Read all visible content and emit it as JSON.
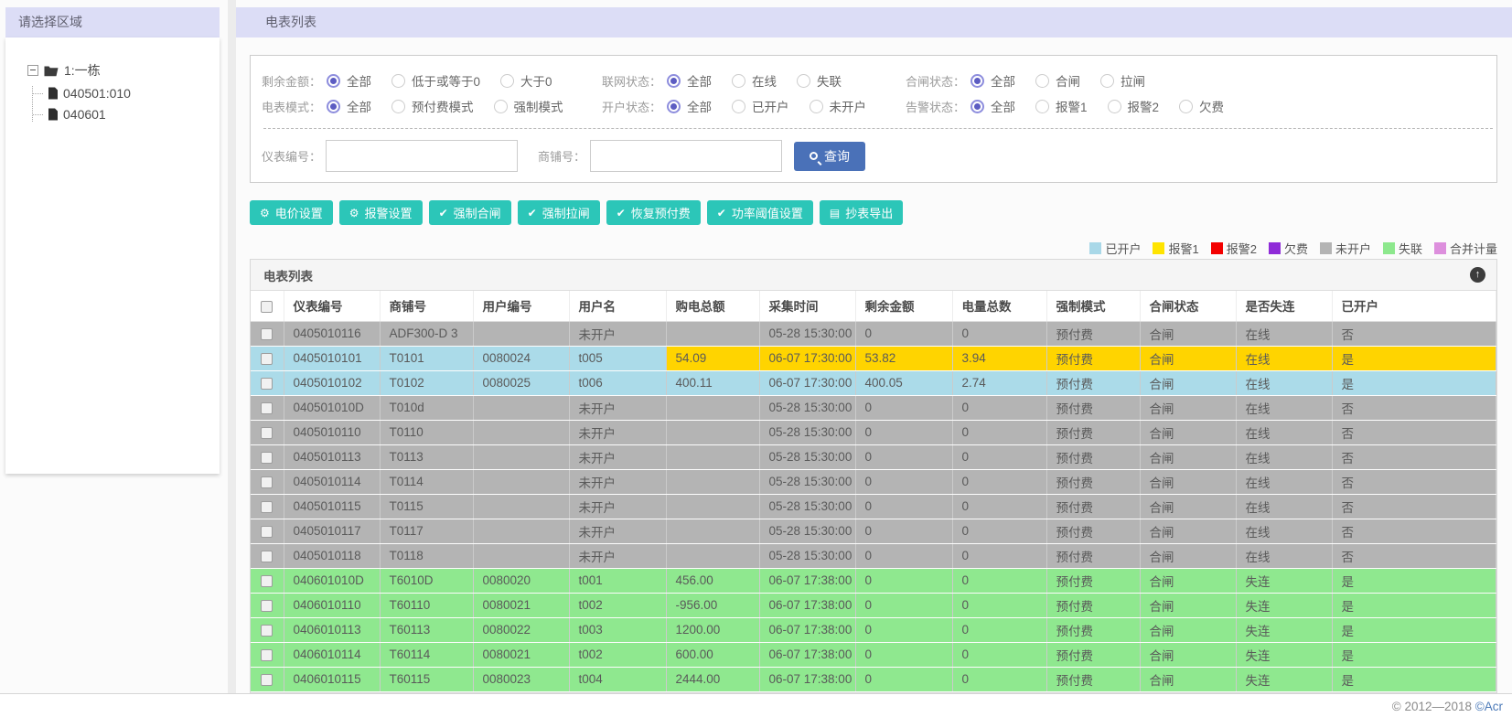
{
  "theme": {
    "lavender": "#dcddf6",
    "teal": "#2cc6b8",
    "blue-btn": "#4a71b8",
    "c-gray": "#b4b4b4",
    "c-blue": "#abdbe9",
    "c-green": "#8fe88f",
    "c-yellow": "#ffd400"
  },
  "sidebar": {
    "title": "请选择区域",
    "tree": {
      "root_label": "1:一栋",
      "children": [
        "040501:010",
        "040601"
      ]
    }
  },
  "header": {
    "title": "电表列表"
  },
  "filters": {
    "rows": [
      [
        {
          "label": "剩余金额：",
          "options": [
            "全部",
            "低于或等于0",
            "大于0"
          ],
          "selected": 0
        },
        {
          "label": "联网状态：",
          "options": [
            "全部",
            "在线",
            "失联"
          ],
          "selected": 0
        },
        {
          "label": "合闸状态：",
          "options": [
            "全部",
            "合闸",
            "拉闸"
          ],
          "selected": 0
        }
      ],
      [
        {
          "label": "电表模式：",
          "options": [
            "全部",
            "预付费模式",
            "强制模式"
          ],
          "selected": 0
        },
        {
          "label": "开户状态：",
          "options": [
            "全部",
            "已开户",
            "未开户"
          ],
          "selected": 0
        },
        {
          "label": "告警状态：",
          "options": [
            "全部",
            "报警1",
            "报警2",
            "欠费"
          ],
          "selected": 0
        }
      ]
    ],
    "search": {
      "meter_no_label": "仪表编号：",
      "meter_no_value": "",
      "shop_no_label": "商铺号：",
      "shop_no_value": "",
      "query_button": "查询"
    }
  },
  "actions": [
    {
      "icon": "gear",
      "label": "电价设置"
    },
    {
      "icon": "gear",
      "label": "报警设置"
    },
    {
      "icon": "check",
      "label": "强制合闸"
    },
    {
      "icon": "check",
      "label": "强制拉闸"
    },
    {
      "icon": "check",
      "label": "恢复预付费"
    },
    {
      "icon": "check",
      "label": "功率阈值设置"
    },
    {
      "icon": "file",
      "label": "抄表导出"
    }
  ],
  "legend": [
    {
      "label": "已开户",
      "color": "#a9d8e8"
    },
    {
      "label": "报警1",
      "color": "#ffe400"
    },
    {
      "label": "报警2",
      "color": "#f30000"
    },
    {
      "label": "欠费",
      "color": "#8f2bd8"
    },
    {
      "label": "未开户",
      "color": "#b4b4b4"
    },
    {
      "label": "失联",
      "color": "#8de88d"
    },
    {
      "label": "合并计量",
      "color": "#dd8fdd"
    }
  ],
  "table": {
    "panel_title": "电表列表",
    "columns": [
      "仪表编号",
      "商铺号",
      "用户编号",
      "用户名",
      "购电总额",
      "采集时间",
      "剩余金额",
      "电量总数",
      "强制模式",
      "合闸状态",
      "是否失连",
      "已开户"
    ],
    "rows": [
      {
        "color": "gray",
        "cells": [
          "0405010116",
          "ADF300-D 3",
          "",
          "未开户",
          "",
          "05-28 15:30:00",
          "0",
          "0",
          "预付费",
          "合闸",
          "在线",
          "否"
        ]
      },
      {
        "color": "blue",
        "highlight_from": 4,
        "highlight": "yellow",
        "cells": [
          "0405010101",
          "T0101",
          "0080024",
          "t005",
          "54.09",
          "06-07 17:30:00",
          "53.82",
          "3.94",
          "预付费",
          "合闸",
          "在线",
          "是"
        ]
      },
      {
        "color": "blue",
        "cells": [
          "0405010102",
          "T0102",
          "0080025",
          "t006",
          "400.11",
          "06-07 17:30:00",
          "400.05",
          "2.74",
          "预付费",
          "合闸",
          "在线",
          "是"
        ]
      },
      {
        "color": "gray",
        "cells": [
          "040501010D",
          "T010d",
          "",
          "未开户",
          "",
          "05-28 15:30:00",
          "0",
          "0",
          "预付费",
          "合闸",
          "在线",
          "否"
        ]
      },
      {
        "color": "gray",
        "cells": [
          "0405010110",
          "T0110",
          "",
          "未开户",
          "",
          "05-28 15:30:00",
          "0",
          "0",
          "预付费",
          "合闸",
          "在线",
          "否"
        ]
      },
      {
        "color": "gray",
        "cells": [
          "0405010113",
          "T0113",
          "",
          "未开户",
          "",
          "05-28 15:30:00",
          "0",
          "0",
          "预付费",
          "合闸",
          "在线",
          "否"
        ]
      },
      {
        "color": "gray",
        "cells": [
          "0405010114",
          "T0114",
          "",
          "未开户",
          "",
          "05-28 15:30:00",
          "0",
          "0",
          "预付费",
          "合闸",
          "在线",
          "否"
        ]
      },
      {
        "color": "gray",
        "cells": [
          "0405010115",
          "T0115",
          "",
          "未开户",
          "",
          "05-28 15:30:00",
          "0",
          "0",
          "预付费",
          "合闸",
          "在线",
          "否"
        ]
      },
      {
        "color": "gray",
        "cells": [
          "0405010117",
          "T0117",
          "",
          "未开户",
          "",
          "05-28 15:30:00",
          "0",
          "0",
          "预付费",
          "合闸",
          "在线",
          "否"
        ]
      },
      {
        "color": "gray",
        "cells": [
          "0405010118",
          "T0118",
          "",
          "未开户",
          "",
          "05-28 15:30:00",
          "0",
          "0",
          "预付费",
          "合闸",
          "在线",
          "否"
        ]
      },
      {
        "color": "green",
        "cells": [
          "040601010D",
          "T6010D",
          "0080020",
          "t001",
          "456.00",
          "06-07 17:38:00",
          "0",
          "0",
          "预付费",
          "合闸",
          "失连",
          "是"
        ]
      },
      {
        "color": "green",
        "cells": [
          "0406010110",
          "T60110",
          "0080021",
          "t002",
          "-956.00",
          "06-07 17:38:00",
          "0",
          "0",
          "预付费",
          "合闸",
          "失连",
          "是"
        ]
      },
      {
        "color": "green",
        "cells": [
          "0406010113",
          "T60113",
          "0080022",
          "t003",
          "1200.00",
          "06-07 17:38:00",
          "0",
          "0",
          "预付费",
          "合闸",
          "失连",
          "是"
        ]
      },
      {
        "color": "green",
        "cells": [
          "0406010114",
          "T60114",
          "0080021",
          "t002",
          "600.00",
          "06-07 17:38:00",
          "0",
          "0",
          "预付费",
          "合闸",
          "失连",
          "是"
        ]
      },
      {
        "color": "green",
        "cells": [
          "0406010115",
          "T60115",
          "0080023",
          "t004",
          "2444.00",
          "06-07 17:38:00",
          "0",
          "0",
          "预付费",
          "合闸",
          "失连",
          "是"
        ]
      }
    ]
  },
  "footer": {
    "copyright_left": "© 2012—2018 ",
    "copyright_right": "©Acr"
  }
}
